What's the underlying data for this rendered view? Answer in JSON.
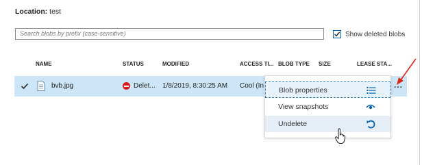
{
  "location": {
    "label": "Location:",
    "value": "test"
  },
  "search": {
    "placeholder": "Search blobs by prefix (case-sensitive)"
  },
  "show_deleted": {
    "label": "Show deleted blobs",
    "checked": true
  },
  "columns": [
    "NAME",
    "STATUS",
    "MODIFIED",
    "ACCESS TI...",
    "BLOB TYPE",
    "SIZE",
    "LEASE STA..."
  ],
  "row": {
    "name": "bvb.jpg",
    "status": "Delet...",
    "modified": "1/8/2019, 8:30:25 AM",
    "access_tier": "Cool (In",
    "checked": true
  },
  "context_menu": {
    "items": [
      {
        "label": "Blob properties",
        "icon": "list-icon"
      },
      {
        "label": "View snapshots",
        "icon": "eye-icon"
      },
      {
        "label": "Undelete",
        "icon": "undo-icon"
      }
    ]
  },
  "more_button": {
    "label": "..."
  },
  "colors": {
    "accent": "#0063b1",
    "row_selected": "#cde6f7",
    "status_deleted": "#d81e1e",
    "arrow": "#d9261c"
  }
}
